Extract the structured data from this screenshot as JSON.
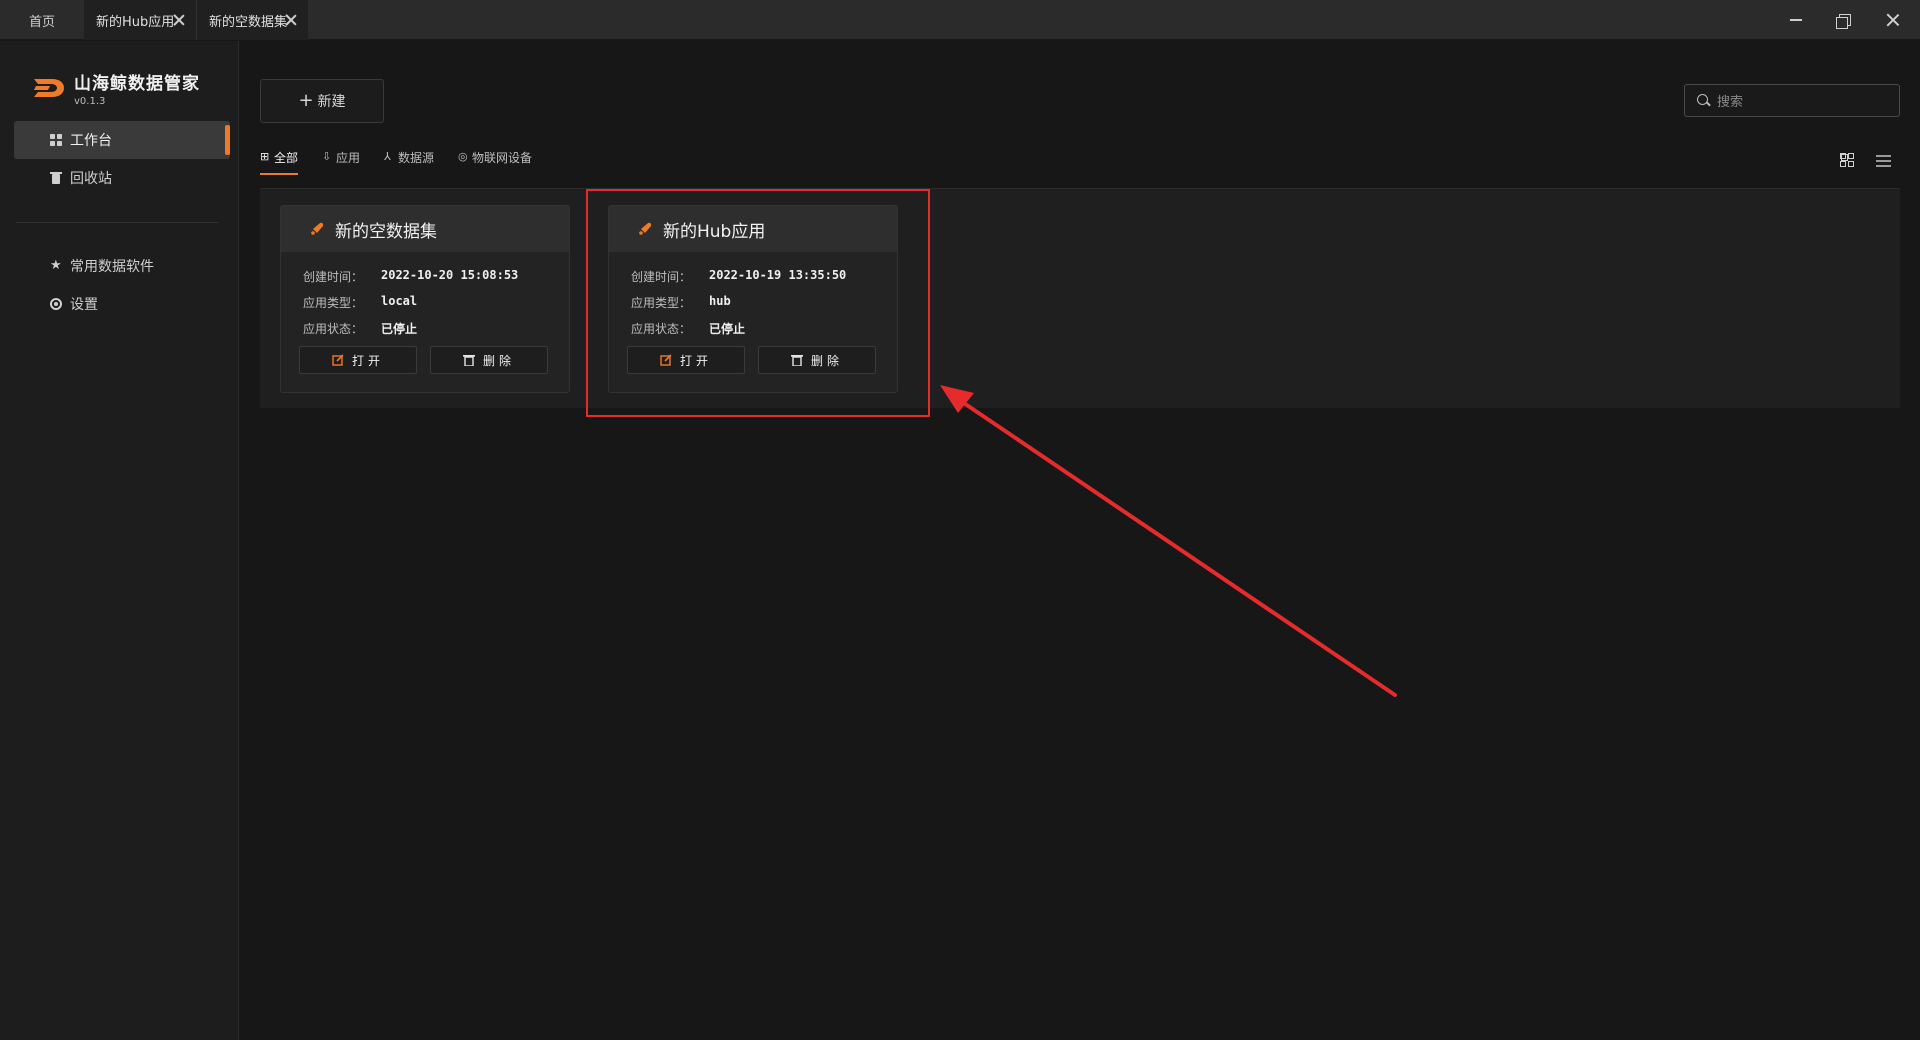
{
  "tabs": [
    {
      "label": "首页"
    },
    {
      "label": "新的Hub应用"
    },
    {
      "label": "新的空数据集"
    }
  ],
  "app": {
    "name": "山海鲸数据管家",
    "version": "v0.1.3"
  },
  "sidebar": {
    "items": [
      {
        "label": "工作台",
        "icon": "grid-icon"
      },
      {
        "label": "回收站",
        "icon": "trash-icon"
      },
      {
        "label": "常用数据软件",
        "icon": "star-icon"
      },
      {
        "label": "设置",
        "icon": "gear-icon"
      }
    ]
  },
  "toolbar": {
    "new_label": "新建",
    "search_placeholder": "搜索"
  },
  "filters": [
    {
      "label": "全部"
    },
    {
      "label": "应用"
    },
    {
      "label": "数据源"
    },
    {
      "label": "物联网设备"
    }
  ],
  "cards": [
    {
      "title": "新的空数据集",
      "rows": [
        {
          "key": "创建时间：",
          "value": "2022-10-20 15:08:53"
        },
        {
          "key": "应用类型：",
          "value": "local"
        },
        {
          "key": "应用状态：",
          "value": "已停止"
        }
      ],
      "open_label": "打开",
      "delete_label": "删除"
    },
    {
      "title": "新的Hub应用",
      "rows": [
        {
          "key": "创建时间：",
          "value": "2022-10-19 13:35:50"
        },
        {
          "key": "应用类型：",
          "value": "hub"
        },
        {
          "key": "应用状态：",
          "value": "已停止"
        }
      ],
      "open_label": "打开",
      "delete_label": "删除"
    }
  ],
  "colors": {
    "accent": "#ef7a2a",
    "annotation": "#e52b2b",
    "background": "#171717"
  }
}
